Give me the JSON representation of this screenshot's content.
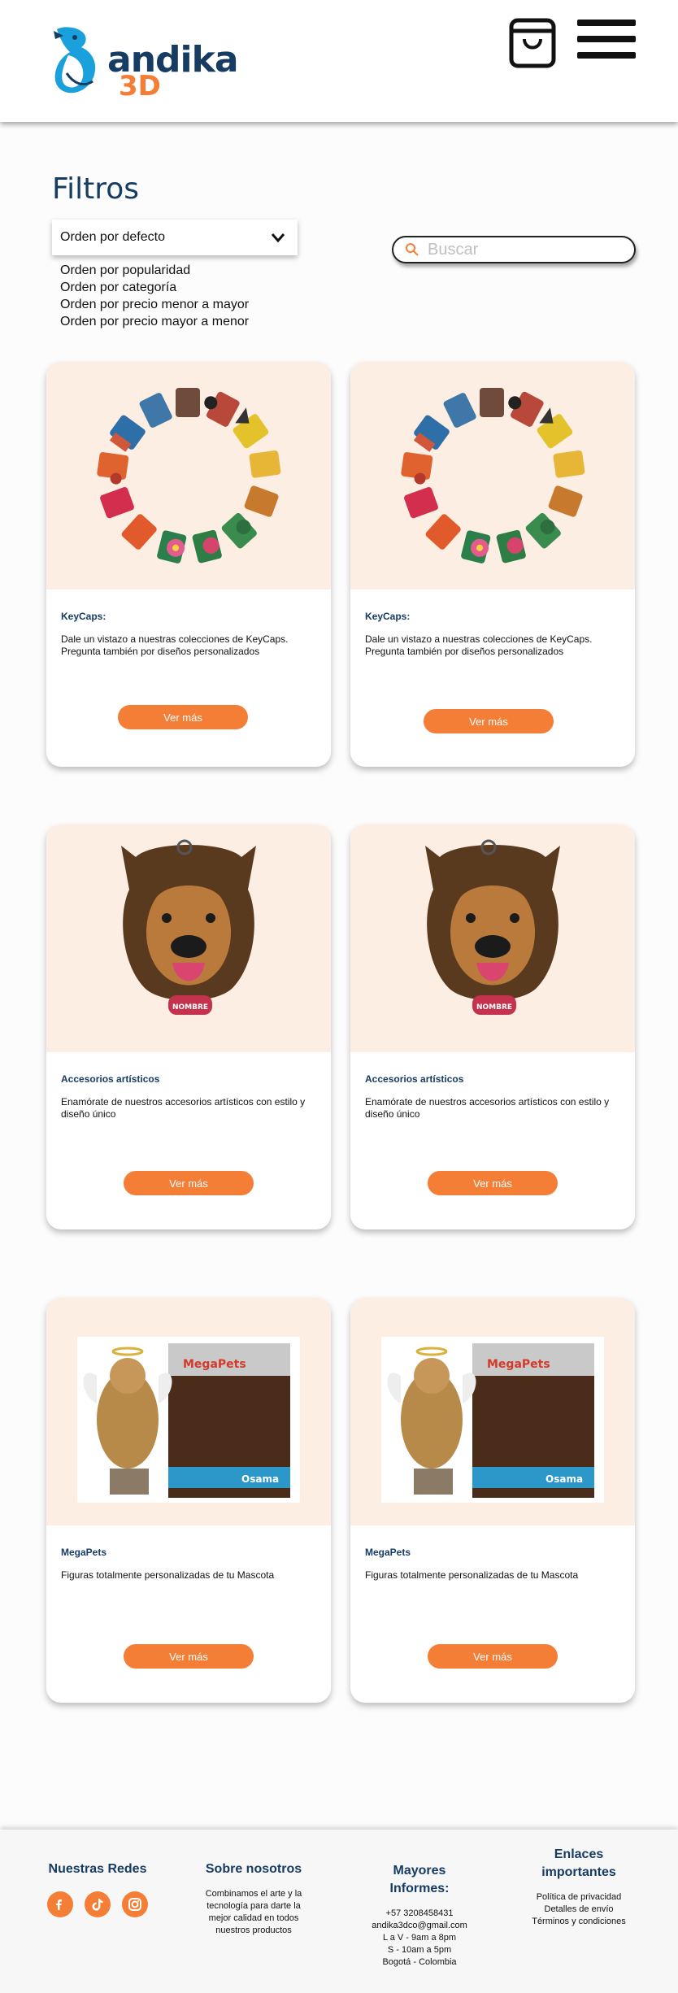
{
  "header": {
    "logo_word": "andika",
    "logo_sub": "3D",
    "cart_icon": "shopping-bag-icon",
    "menu_icon": "hamburger-menu-icon"
  },
  "filters": {
    "title": "Filtros",
    "selected": "Orden por defecto",
    "options": [
      "Orden por popularidad",
      "Orden por categoría",
      "Orden por precio menor a mayor",
      "Orden por precio mayor a menor"
    ]
  },
  "search": {
    "placeholder": "Buscar"
  },
  "products": [
    {
      "title": "KeyCaps:",
      "desc": "Dale un vistazo a nuestras colecciones de KeyCaps. Pregunta también por diseños personalizados",
      "button": "Ver más"
    },
    {
      "title": "KeyCaps:",
      "desc": "Dale un vistazo a nuestras colecciones de KeyCaps. Pregunta también por diseños personalizados",
      "button": "Ver más"
    },
    {
      "title": "Accesorios artísticos",
      "desc": "Enamórate de nuestros accesorios artísticos con estilo y diseño único",
      "button": "Ver más"
    },
    {
      "title": "Accesorios artísticos",
      "desc": "Enamórate de nuestros accesorios artísticos con estilo y diseño único",
      "button": "Ver más"
    },
    {
      "title": "MegaPets",
      "desc": "Figuras totalmente personalizadas de tu Mascota",
      "button": "Ver más"
    },
    {
      "title": "MegaPets",
      "desc": "Figuras totalmente personalizadas de tu Mascota",
      "button": "Ver más"
    }
  ],
  "images": {
    "dog_tag": "NOMBRE",
    "box_brand": "MegaPets",
    "box_name": "Osama"
  },
  "footer": {
    "social_title": "Nuestras Redes",
    "social_icons": [
      "facebook-icon",
      "tiktok-icon",
      "instagram-icon"
    ],
    "about_title": "Sobre nosotros",
    "about_text": "Combinamos el arte y la tecnología para darte la mejor calidad en todos nuestros productos",
    "wholesale_title_1": "Mayores",
    "wholesale_title_2": "Informes:",
    "wholesale_lines": [
      "+57 3208458431",
      "andika3dco@gmail.com",
      "L a V - 9am a 8pm",
      "S - 10am a 5pm",
      "Bogotá - Colombia"
    ],
    "links_title_1": "Enlaces",
    "links_title_2": "importantes",
    "links": [
      "Política de privacidad",
      "Detalles de envío",
      "Términos y condiciones"
    ]
  },
  "colors": {
    "brand_blue": "#163c63",
    "accent_orange": "#f57e36",
    "card_bg": "#fdeee4"
  }
}
